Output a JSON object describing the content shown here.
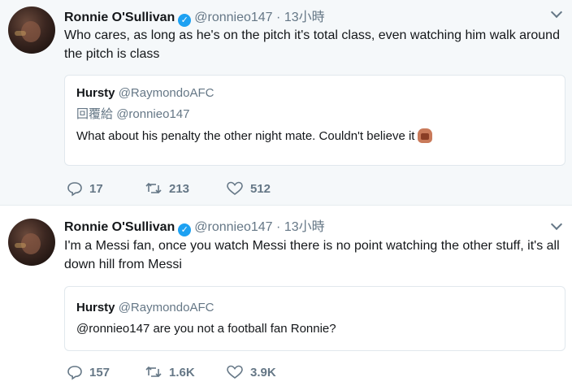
{
  "tweets": [
    {
      "author": "Ronnie O'Sullivan",
      "handle": "@ronnieo147",
      "separator": "·",
      "time": "13小時",
      "text": "Who cares, as long as he's on the pitch it's total class, even watching him walk around the pitch is class",
      "quote": {
        "author": "Hursty",
        "handle": "@RaymondoAFC",
        "reply_label": "回覆給",
        "reply_to": "@ronnieo147",
        "text": "What about his penalty the other night mate. Couldn't believe it"
      },
      "replies": "17",
      "retweets": "213",
      "likes": "512"
    },
    {
      "author": "Ronnie O'Sullivan",
      "handle": "@ronnieo147",
      "separator": "·",
      "time": "13小時",
      "text": "I'm a Messi fan, once you watch Messi there is no point watching the other stuff, it's all down hill from Messi",
      "quote": {
        "author": "Hursty",
        "handle": "@RaymondoAFC",
        "text": "@ronnieo147 are you not a football fan Ronnie?"
      },
      "replies": "157",
      "retweets": "1.6K",
      "likes": "3.9K"
    }
  ],
  "icons": {
    "reply": "reply-icon",
    "retweet": "retweet-icon",
    "like": "heart-icon",
    "verified": "verified-badge-icon",
    "menu": "chevron-down-icon",
    "emoji": "grimace-emoji-icon"
  }
}
